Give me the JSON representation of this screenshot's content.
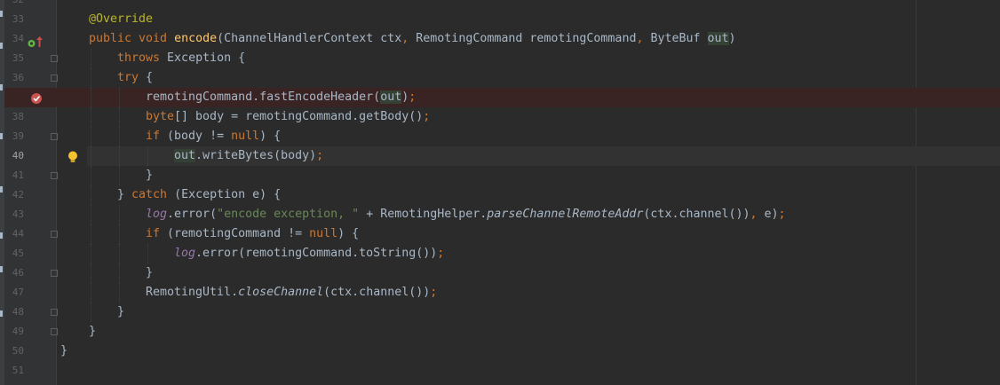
{
  "editor": {
    "language": "java",
    "current_line": 40,
    "error_line": 37,
    "colors": {
      "background": "#2b2b2b",
      "gutter": "#313335",
      "keyword": "#cc7832",
      "annotation": "#bbb529",
      "method_decl": "#ffc66d",
      "string": "#6a8759",
      "static_field": "#9876aa",
      "text": "#a9b7c6",
      "error_line_bg": "#3a2323"
    },
    "gutter_icons": {
      "line_34": [
        "implementing-method-icon",
        "override-up-arrow-icon"
      ],
      "line_37": "breakpoint-icon",
      "line_40": "intention-bulb-icon"
    },
    "lines": [
      {
        "n": "32",
        "indent": 0,
        "tokens": []
      },
      {
        "n": "33",
        "indent": 1,
        "tokens": [
          {
            "t": "@Override",
            "c": "ann"
          }
        ]
      },
      {
        "n": "34",
        "indent": 1,
        "tokens": [
          {
            "t": "public void ",
            "c": "kw"
          },
          {
            "t": "encode",
            "c": "fn"
          },
          {
            "t": "(ChannelHandlerContext ctx"
          },
          {
            "t": ", ",
            "c": "kw"
          },
          {
            "t": "RemotingCommand remotingCommand"
          },
          {
            "t": ", ",
            "c": "kw"
          },
          {
            "t": "ByteBuf "
          },
          {
            "t": "out",
            "c": "hl"
          },
          {
            "t": ")"
          }
        ]
      },
      {
        "n": "35",
        "indent": 2,
        "tokens": [
          {
            "t": "throws ",
            "c": "kw"
          },
          {
            "t": "Exception {"
          }
        ]
      },
      {
        "n": "36",
        "indent": 2,
        "tokens": [
          {
            "t": "try ",
            "c": "kw"
          },
          {
            "t": "{"
          }
        ]
      },
      {
        "n": "37",
        "indent": 3,
        "tokens": [
          {
            "t": "remotingCommand.fastEncodeHeader("
          },
          {
            "t": "out",
            "c": "hl"
          },
          {
            "t": ")"
          },
          {
            "t": ";",
            "c": "kw"
          }
        ]
      },
      {
        "n": "38",
        "indent": 3,
        "tokens": [
          {
            "t": "byte",
            "c": "kw"
          },
          {
            "t": "[] body = remotingCommand.getBody()"
          },
          {
            "t": ";",
            "c": "kw"
          }
        ]
      },
      {
        "n": "39",
        "indent": 3,
        "tokens": [
          {
            "t": "if ",
            "c": "kw"
          },
          {
            "t": "(body != "
          },
          {
            "t": "null",
            "c": "kw"
          },
          {
            "t": ") {"
          }
        ]
      },
      {
        "n": "40",
        "indent": 4,
        "tokens": [
          {
            "t": "out",
            "c": "hl"
          },
          {
            "t": ".writeBytes(body)"
          },
          {
            "t": ";",
            "c": "kw"
          }
        ]
      },
      {
        "n": "41",
        "indent": 3,
        "tokens": [
          {
            "t": "}"
          }
        ]
      },
      {
        "n": "42",
        "indent": 2,
        "tokens": [
          {
            "t": "} "
          },
          {
            "t": "catch ",
            "c": "kw"
          },
          {
            "t": "(Exception e) {"
          }
        ]
      },
      {
        "n": "43",
        "indent": 3,
        "tokens": [
          {
            "t": "log",
            "c": "fld"
          },
          {
            "t": ".error("
          },
          {
            "t": "\"encode exception, \" ",
            "c": "str"
          },
          {
            "t": "+ RemotingHelper."
          },
          {
            "t": "parseChannelRemoteAddr",
            "c": "it"
          },
          {
            "t": "(ctx.channel())"
          },
          {
            "t": ", ",
            "c": "kw"
          },
          {
            "t": "e)"
          },
          {
            "t": ";",
            "c": "kw"
          }
        ]
      },
      {
        "n": "44",
        "indent": 3,
        "tokens": [
          {
            "t": "if ",
            "c": "kw"
          },
          {
            "t": "(remotingCommand != "
          },
          {
            "t": "null",
            "c": "kw"
          },
          {
            "t": ") {"
          }
        ]
      },
      {
        "n": "45",
        "indent": 4,
        "tokens": [
          {
            "t": "log",
            "c": "fld"
          },
          {
            "t": ".error(remotingCommand.toString())"
          },
          {
            "t": ";",
            "c": "kw"
          }
        ]
      },
      {
        "n": "46",
        "indent": 3,
        "tokens": [
          {
            "t": "}"
          }
        ]
      },
      {
        "n": "47",
        "indent": 3,
        "tokens": [
          {
            "t": "RemotingUtil."
          },
          {
            "t": "closeChannel",
            "c": "it"
          },
          {
            "t": "(ctx.channel())"
          },
          {
            "t": ";",
            "c": "kw"
          }
        ]
      },
      {
        "n": "48",
        "indent": 2,
        "tokens": [
          {
            "t": "}"
          }
        ]
      },
      {
        "n": "49",
        "indent": 1,
        "tokens": [
          {
            "t": "}"
          }
        ]
      },
      {
        "n": "50",
        "indent": 0,
        "tokens": [
          {
            "t": "}"
          }
        ]
      },
      {
        "n": "51",
        "indent": 0,
        "tokens": []
      }
    ]
  }
}
